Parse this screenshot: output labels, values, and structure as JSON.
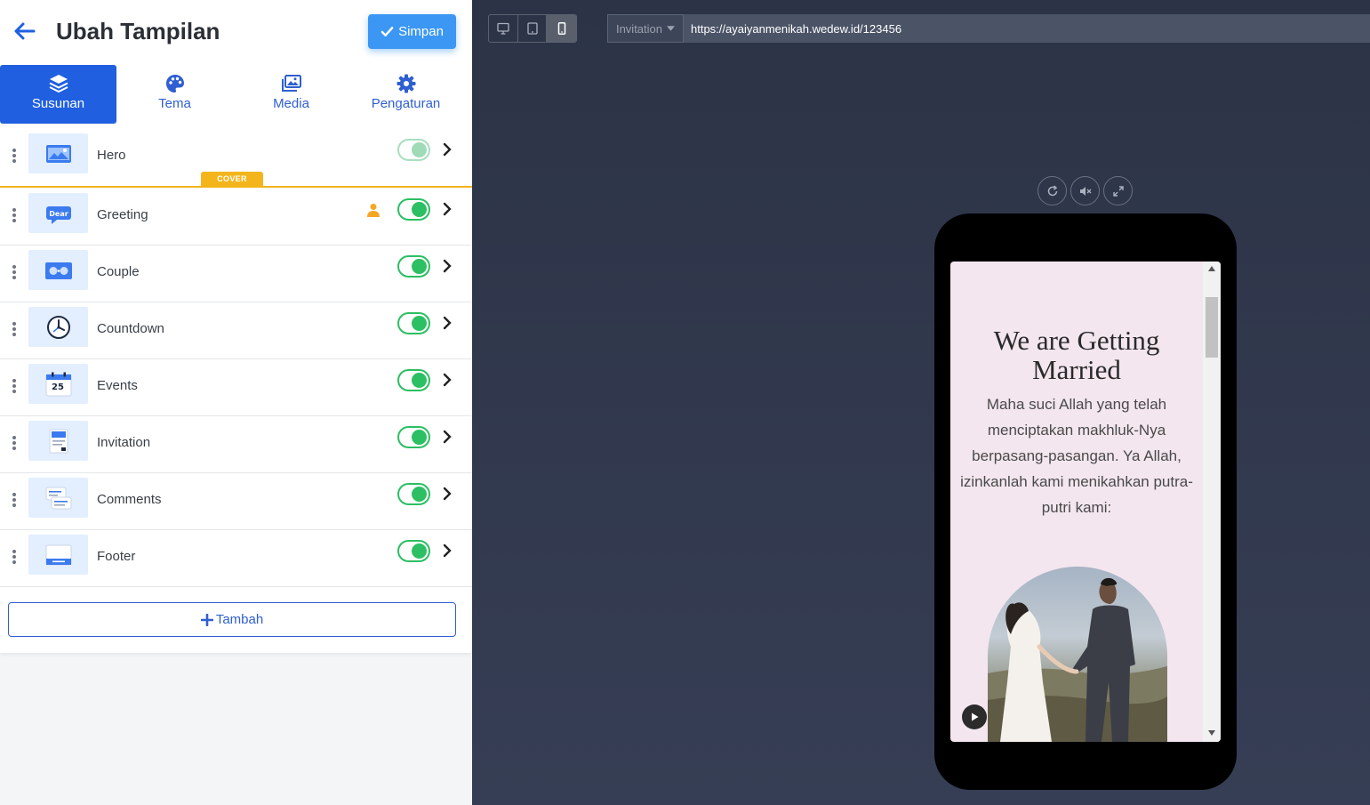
{
  "header": {
    "title": "Ubah Tampilan",
    "save_label": "Simpan"
  },
  "tabs": [
    {
      "label": "Susunan",
      "icon": "layers-icon",
      "active": true
    },
    {
      "label": "Tema",
      "icon": "palette-icon",
      "active": false
    },
    {
      "label": "Media",
      "icon": "images-icon",
      "active": false
    },
    {
      "label": "Pengaturan",
      "icon": "gear-icon",
      "active": false
    }
  ],
  "sections": [
    {
      "label": "Hero",
      "icon": "hero-image-icon",
      "enabled": true,
      "badge": "COVER"
    },
    {
      "label": "Greeting",
      "icon": "greeting-dear-icon",
      "enabled": true,
      "user_marker": "user-icon"
    },
    {
      "label": "Couple",
      "icon": "couple-icon",
      "enabled": true
    },
    {
      "label": "Countdown",
      "icon": "clock-icon",
      "enabled": true
    },
    {
      "label": "Events",
      "icon": "calendar-icon",
      "calendar_day": "25",
      "enabled": true
    },
    {
      "label": "Invitation",
      "icon": "invitation-card-icon",
      "enabled": true
    },
    {
      "label": "Comments",
      "icon": "comments-icon",
      "enabled": true
    },
    {
      "label": "Footer",
      "icon": "footer-icon",
      "enabled": true
    }
  ],
  "add_button": {
    "label": "Tambah"
  },
  "preview": {
    "device_modes": [
      "desktop-icon",
      "tablet-icon",
      "mobile-icon"
    ],
    "selected_device": "mobile",
    "page_select": "Invitation",
    "url": "https://ayaiyanmenikah.wedew.id/123456",
    "media_controls": [
      "refresh-icon",
      "mute-icon",
      "expand-icon"
    ],
    "invitation": {
      "title": "We are Getting Married",
      "body": "Maha suci Allah yang telah menciptakan makhluk-Nya berpasang-pasangan. Ya Allah, izinkanlah kami menikahkan putra-putri kami:"
    }
  },
  "colors": {
    "primary": "#1f5fe0",
    "save_button": "#3b97f3",
    "toggle_on": "#2cbf63",
    "cover_badge": "#f3b51b",
    "preview_bg": "#333d52",
    "invitation_bg": "#f3e6ef"
  }
}
